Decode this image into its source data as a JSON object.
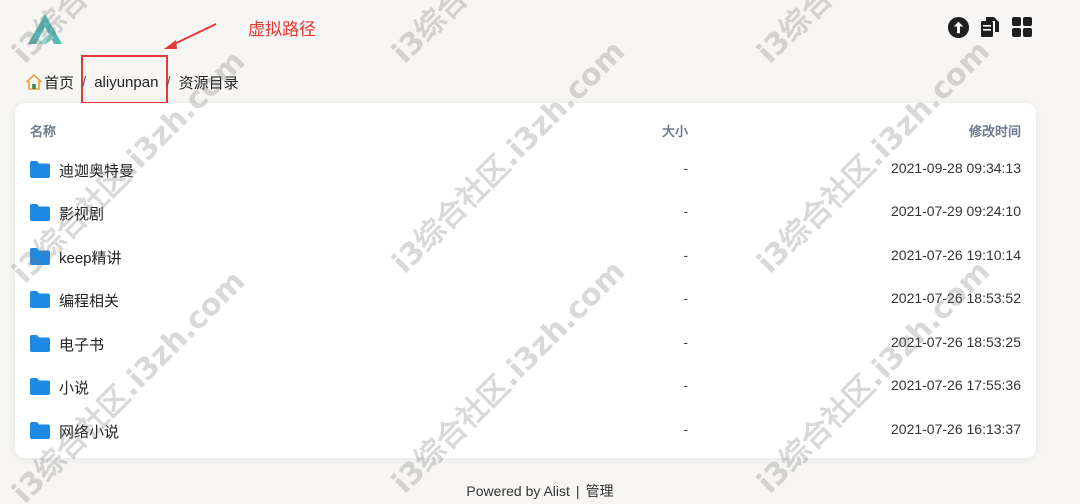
{
  "annotation": {
    "label": "虚拟路径"
  },
  "toolbar": {
    "icons": [
      "upload-icon",
      "copy-icon",
      "grid-view-icon"
    ]
  },
  "breadcrumb": {
    "home": "首页",
    "separator": "/",
    "items": [
      "aliyunpan",
      "资源目录"
    ]
  },
  "table": {
    "headers": {
      "name": "名称",
      "size": "大小",
      "modified": "修改时间"
    },
    "rows": [
      {
        "name": "迪迦奥特曼",
        "size": "-",
        "modified": "2021-09-28 09:34:13"
      },
      {
        "name": "影视剧",
        "size": "-",
        "modified": "2021-07-29 09:24:10"
      },
      {
        "name": "keep精讲",
        "size": "-",
        "modified": "2021-07-26 19:10:14"
      },
      {
        "name": "编程相关",
        "size": "-",
        "modified": "2021-07-26 18:53:52"
      },
      {
        "name": "电子书",
        "size": "-",
        "modified": "2021-07-26 18:53:25"
      },
      {
        "name": "小说",
        "size": "-",
        "modified": "2021-07-26 17:55:36"
      },
      {
        "name": "网络小说",
        "size": "-",
        "modified": "2021-07-26 16:13:37"
      }
    ]
  },
  "footer": {
    "powered": "Powered by Alist",
    "separator": "|",
    "manage": "管理"
  },
  "watermark": {
    "text": "i3综合社区.i3zh.com"
  },
  "colors": {
    "accent": "#2196f3",
    "folder": "#1e88e5",
    "annotation": "#e53935",
    "logo": "#53b8b0"
  }
}
